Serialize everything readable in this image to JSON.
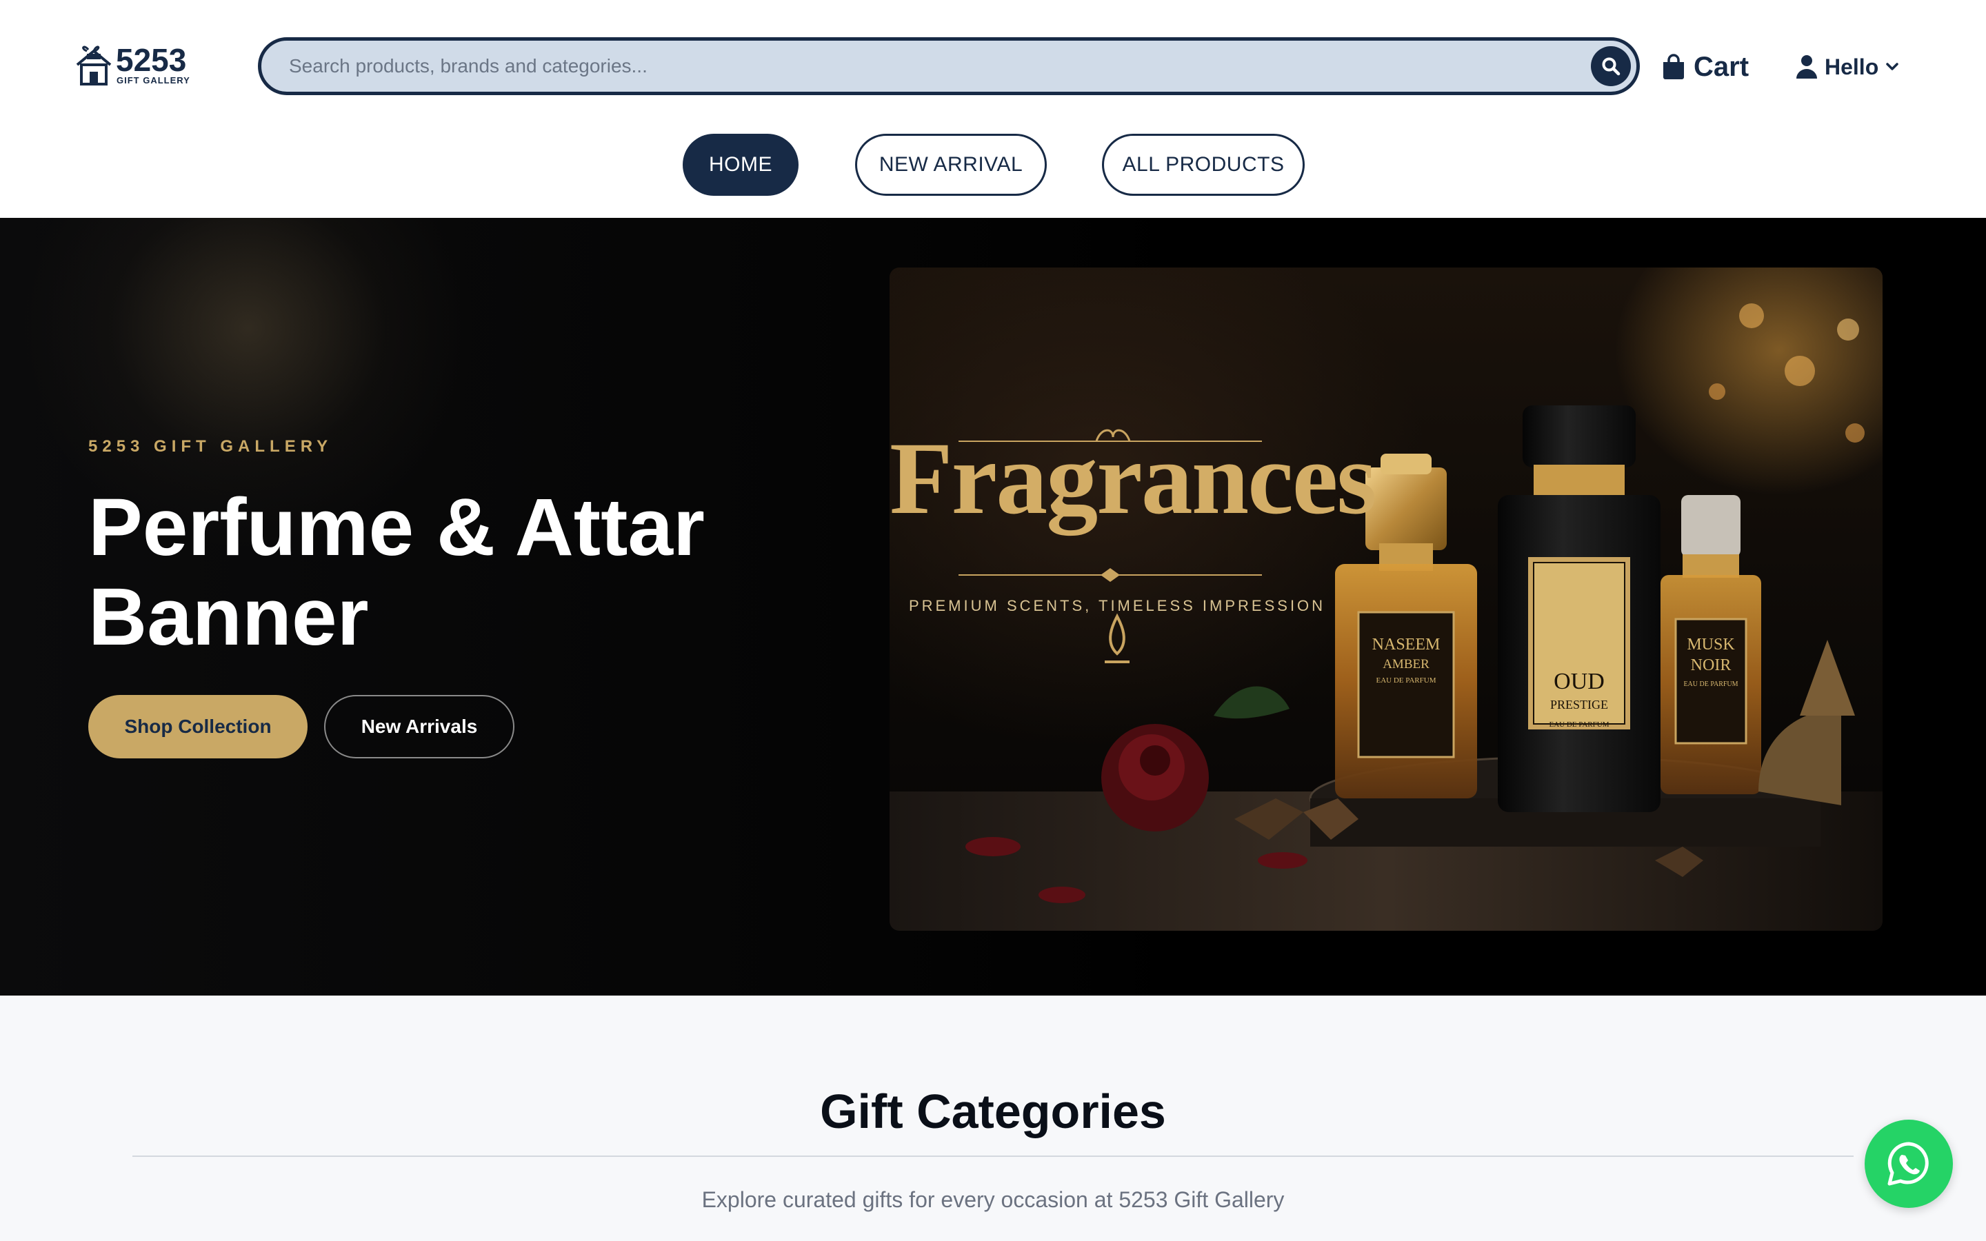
{
  "brand": {
    "name": "5253",
    "tagline": "GIFT GALLERY",
    "logo_icon": "gift-house-icon",
    "color": "#172a46"
  },
  "search": {
    "placeholder": "Search products, brands and categories...",
    "value": "",
    "icon": "search-icon"
  },
  "header": {
    "cart_label": "Cart",
    "cart_icon": "shopping-bag-icon",
    "account_label": "Hello",
    "account_icon": "user-icon"
  },
  "nav": {
    "items": [
      {
        "label": "HOME",
        "active": true
      },
      {
        "label": "NEW ARRIVAL",
        "active": false
      },
      {
        "label": "ALL PRODUCTS",
        "active": false
      }
    ]
  },
  "hero": {
    "kicker": "5253 GIFT GALLERY",
    "title": "Perfume & Attar Banner",
    "primary_cta": "Shop Collection",
    "secondary_cta": "New Arrivals",
    "accent": "#c9a865",
    "banner": {
      "heading": "Fragrances",
      "tagline": "PREMIUM SCENTS, TIMELESS IMPRESSION",
      "bottles": [
        {
          "name": "NASEEM",
          "sub": "AMBER",
          "type": "EAU DE PARFUM"
        },
        {
          "name": "OUD",
          "sub": "PRESTIGE",
          "type": "EAU DE PARFUM"
        },
        {
          "name": "MUSK",
          "sub": "NOIR",
          "type": "EAU DE PARFUM"
        }
      ]
    }
  },
  "categories": {
    "title": "Gift Categories",
    "subtitle": "Explore curated gifts for every occasion at 5253 Gift Gallery"
  },
  "floating": {
    "whatsapp_icon": "whatsapp-icon",
    "color": "#25d366"
  }
}
